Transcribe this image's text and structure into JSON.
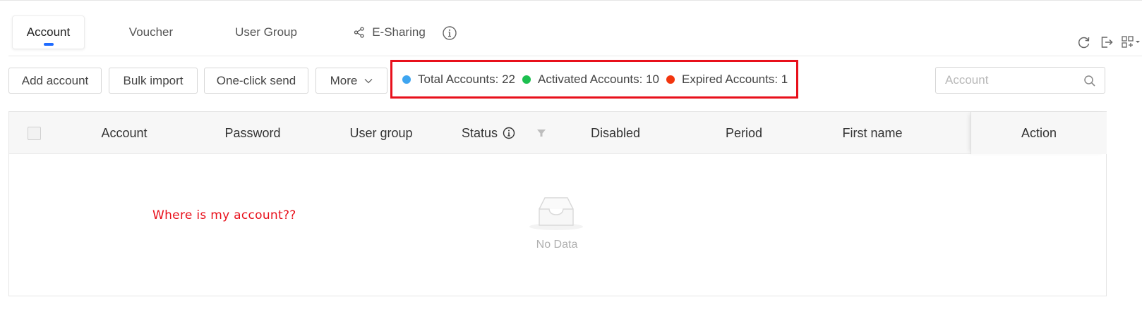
{
  "tabs": [
    {
      "label": "Account",
      "active": true
    },
    {
      "label": "Voucher",
      "active": false
    },
    {
      "label": "User Group",
      "active": false
    },
    {
      "label": "E-Sharing",
      "active": false,
      "icon": "share-icon"
    }
  ],
  "info_icon": "info-circle-icon",
  "tools": [
    "refresh-icon",
    "export-icon",
    "grid-settings-icon"
  ],
  "toolbar": {
    "add_account": "Add account",
    "bulk_import": "Bulk import",
    "one_click_send": "One-click send",
    "more": "More"
  },
  "stats": {
    "total": {
      "label": "Total Accounts: 22",
      "color": "#3ea5f0"
    },
    "activated": {
      "label": "Activated Accounts: 10",
      "color": "#1cbf4f"
    },
    "expired": {
      "label": "Expired Accounts: 1",
      "color": "#f2350e"
    }
  },
  "search": {
    "placeholder": "Account",
    "value": ""
  },
  "table": {
    "columns": [
      "Account",
      "Password",
      "User group",
      "Status",
      "Disabled",
      "Period",
      "First name"
    ],
    "action_column": "Action",
    "empty_text": "No Data"
  },
  "annotation": "Where is my account??",
  "colors": {
    "accent": "#1f6bff",
    "highlight_border": "#e8101b"
  }
}
